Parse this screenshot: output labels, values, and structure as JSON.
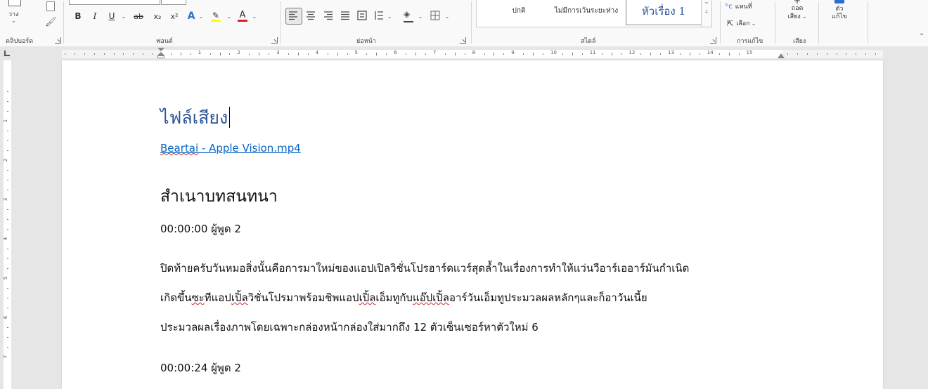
{
  "ribbon": {
    "clipboard": {
      "paste_label": "วาง",
      "group_label": "คลิปบอร์ด"
    },
    "font": {
      "bold": "B",
      "italic": "I",
      "underline": "U",
      "strike": "ab",
      "subscript": "x₂",
      "superscript": "x²",
      "text_effects": "A",
      "highlight": "✎",
      "font_color": "A",
      "group_label": "ฟอนต์"
    },
    "paragraph": {
      "group_label": "ย่อหน้า"
    },
    "styles": {
      "items": [
        "ปกติ",
        "ไม่มีการเว้นระยะห่าง",
        "หัวเรื่อง 1"
      ],
      "group_label": "สไตล์"
    },
    "editing": {
      "replace": "แทนที่",
      "select": "เลือก",
      "group_label": "การแก้ไข"
    },
    "voice": {
      "dictate": "ถอด",
      "dictate2": "เสียง",
      "group_label": "เสียง"
    },
    "editor": {
      "line1": "ตัว",
      "line2": "แก้ไข"
    }
  },
  "ruler": {
    "numbers": [
      "1",
      "2",
      "3",
      "4",
      "5",
      "6",
      "7",
      "8",
      "9",
      "10",
      "11",
      "12",
      "13",
      "14",
      "15"
    ],
    "vnumbers": [
      "1",
      "2",
      "3",
      "4",
      "5",
      "6",
      "7"
    ]
  },
  "document": {
    "title": "ไฟล์เสียง",
    "link": {
      "part1": "Beartai",
      "part2": " - Apple Vision.mp4"
    },
    "heading": "สำเนาบทสนทนา",
    "entries": [
      {
        "timestamp": "00:00:00 ผู้พูด 2",
        "line1": "ปิดท้ายครับวันหมอสิ่งนั้นคือการมาใหม่ของแอปเปิลวิชั่นโปรฮาร์ดแวร์สุดล้ำในเรื่องการทำให้แว่นวีอาร์เออาร์มันกำเนิด",
        "line2": {
          "a": "เกิดขึ้น",
          "b": "ซะ",
          "c": "ทีแอป",
          "d": "เปิ้ล",
          "e": "วิชั่นโปรมาพร้อมชิพแอป",
          "f": "เปิ้ล",
          "g": "เอ็มทูกับ",
          "h": "แอ๊ป",
          "i": "เปิ้ล",
          "j": "อาร์วันเอ็มทูประมวลผลหลักๆและก็อาวันเนี้ย"
        },
        "line3": "ประมวลผลเรื่องภาพโดยเฉพาะกล่องหน้ากล่องใส่มากถึง 12 ตัวเซ็นเซอร์หาตัวใหม่ 6"
      },
      {
        "timestamp": "00:00:24 ผู้พูด 2"
      }
    ]
  },
  "colors": {
    "title": "#2f5496",
    "link": "#0563c1",
    "spell": "#d12a2a"
  }
}
